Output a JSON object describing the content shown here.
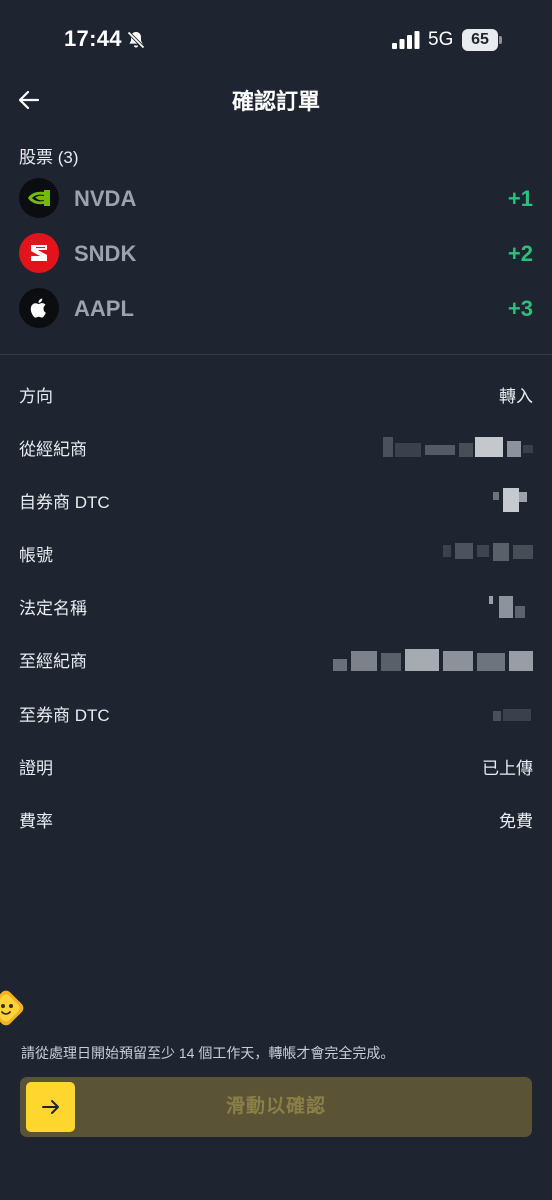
{
  "status_bar": {
    "time": "17:44",
    "network": "5G",
    "battery": "65"
  },
  "header": {
    "title": "確認訂單"
  },
  "stocks": {
    "label": "股票 (3)",
    "items": [
      {
        "ticker": "NVDA",
        "qty": "+1",
        "logo_color": "#0b0d10",
        "icon": "nvidia-icon"
      },
      {
        "ticker": "SNDK",
        "qty": "+2",
        "logo_color": "#e3131b",
        "icon": "sandisk-icon"
      },
      {
        "ticker": "AAPL",
        "qty": "+3",
        "logo_color": "#0b0d10",
        "icon": "apple-icon"
      }
    ]
  },
  "details": {
    "direction": {
      "label": "方向",
      "value": "轉入"
    },
    "from_broker": {
      "label": "從經紀商"
    },
    "from_dtc": {
      "label": "自券商 DTC"
    },
    "account": {
      "label": "帳號"
    },
    "legal_name": {
      "label": "法定名稱"
    },
    "to_broker": {
      "label": "至經紀商"
    },
    "to_dtc": {
      "label": "至券商 DTC"
    },
    "proof": {
      "label": "證明",
      "value": "已上傳"
    },
    "fee": {
      "label": "費率",
      "value": "免費"
    }
  },
  "notice": "請從處理日開始預留至少 14 個工作天，轉帳才會完全完成。",
  "slider": {
    "label": "滑動以確認"
  },
  "colors": {
    "background": "#1f2530",
    "positive": "#2fbf7d",
    "accent": "#ffd62e",
    "slider_track": "#5b5336"
  }
}
